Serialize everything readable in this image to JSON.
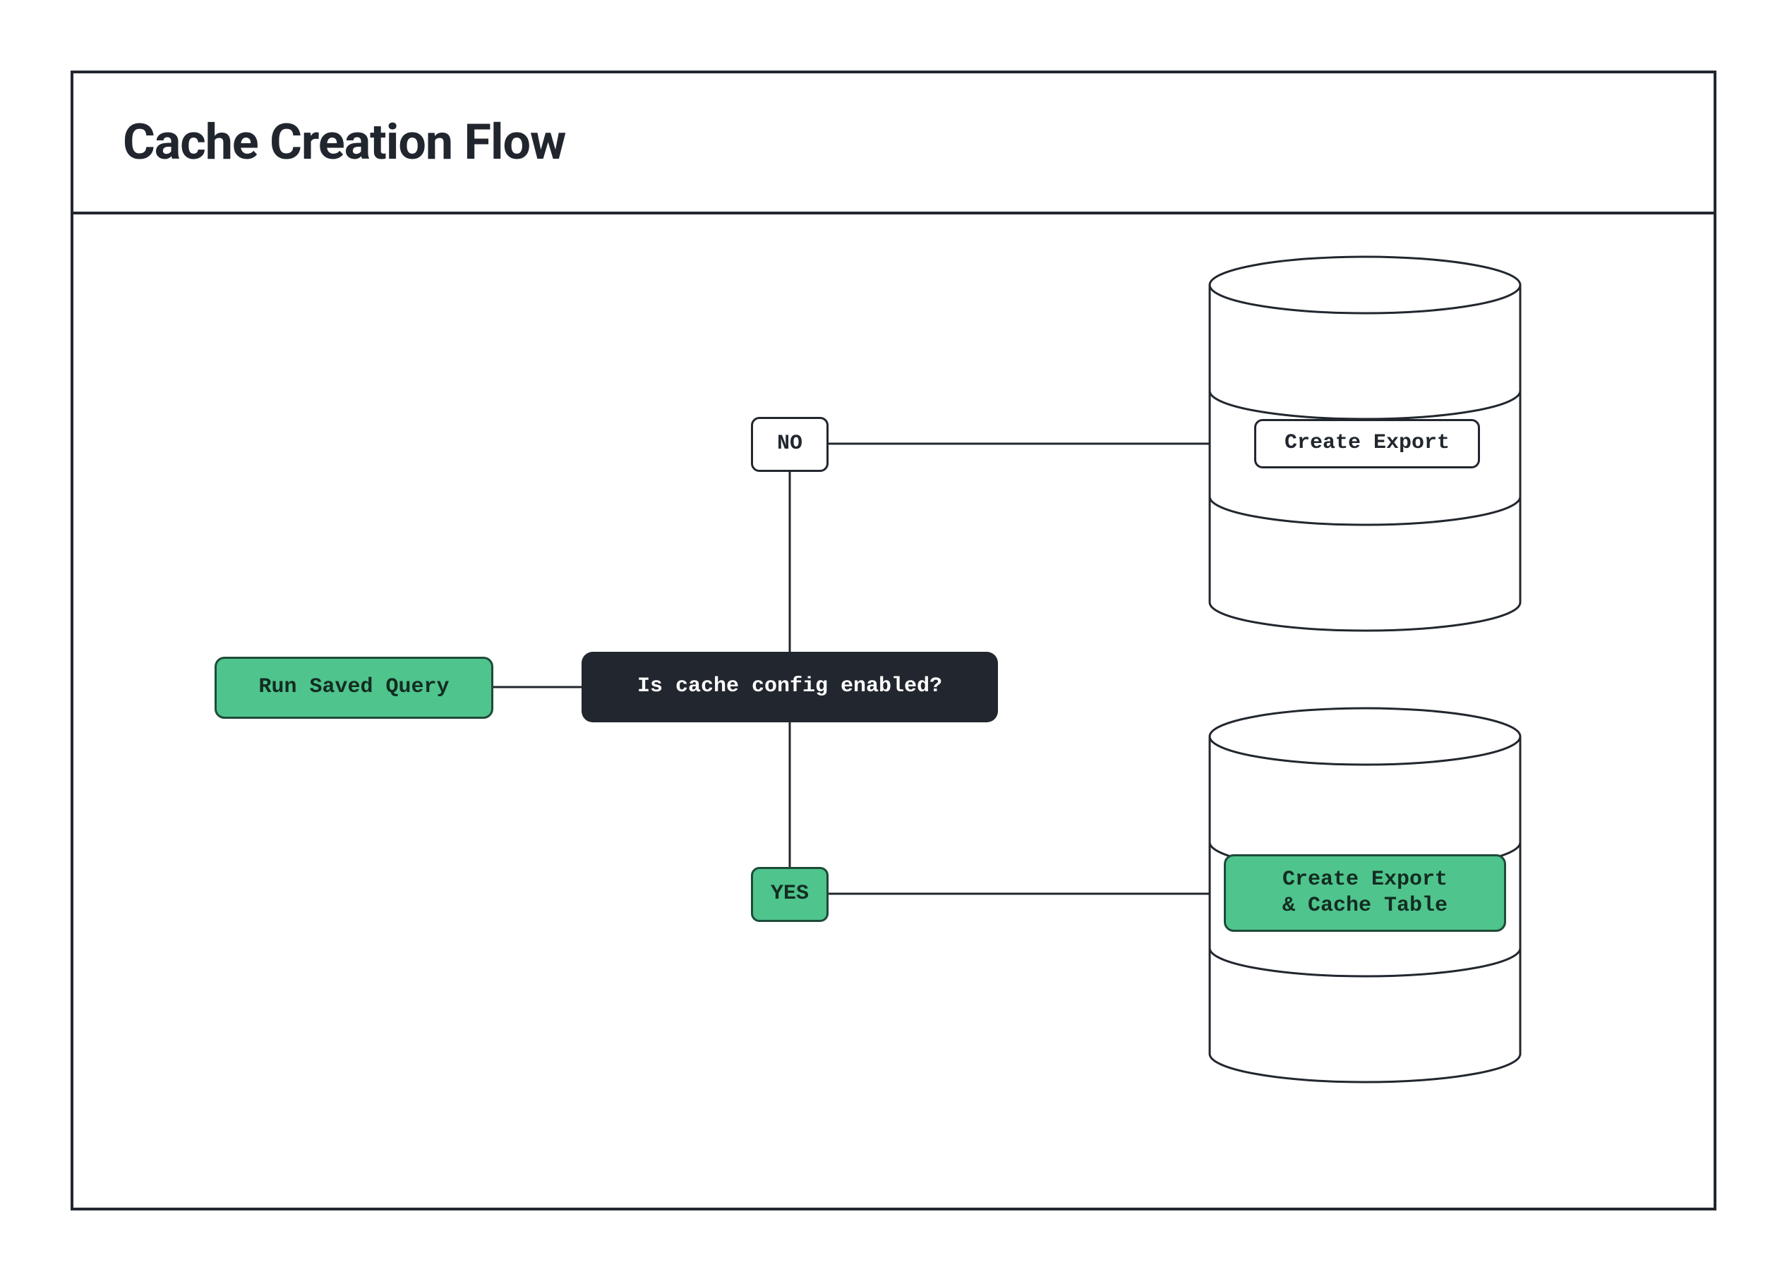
{
  "title": "Cache Creation Flow",
  "nodes": {
    "run": {
      "label": "Run Saved Query"
    },
    "decide": {
      "label": "Is cache config enabled?"
    },
    "no": {
      "label": "NO"
    },
    "yes": {
      "label": "YES"
    },
    "export": {
      "label": "Create Export"
    },
    "cache": {
      "label": "Create Export\n& Cache Table"
    }
  }
}
